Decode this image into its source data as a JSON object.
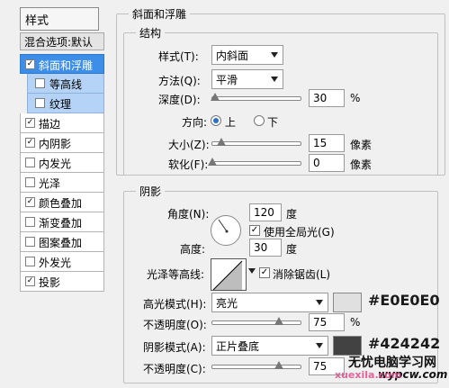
{
  "sidebar": {
    "header": "样式",
    "blend_options": "混合选项:默认",
    "items": [
      {
        "label": "斜面和浮雕",
        "checked": true,
        "selected": true,
        "sub": false
      },
      {
        "label": "等高线",
        "checked": false,
        "selected": false,
        "sub": true
      },
      {
        "label": "纹理",
        "checked": false,
        "selected": false,
        "sub": true
      },
      {
        "label": "描边",
        "checked": true,
        "selected": false,
        "sub": false
      },
      {
        "label": "内阴影",
        "checked": true,
        "selected": false,
        "sub": false
      },
      {
        "label": "内发光",
        "checked": false,
        "selected": false,
        "sub": false
      },
      {
        "label": "光泽",
        "checked": false,
        "selected": false,
        "sub": false
      },
      {
        "label": "颜色叠加",
        "checked": true,
        "selected": false,
        "sub": false
      },
      {
        "label": "渐变叠加",
        "checked": false,
        "selected": false,
        "sub": false
      },
      {
        "label": "图案叠加",
        "checked": false,
        "selected": false,
        "sub": false
      },
      {
        "label": "外发光",
        "checked": false,
        "selected": false,
        "sub": false
      },
      {
        "label": "投影",
        "checked": true,
        "selected": false,
        "sub": false
      }
    ]
  },
  "bevel": {
    "title": "斜面和浮雕",
    "structure": {
      "title": "结构",
      "style_label": "样式(T):",
      "style_value": "内斜面",
      "technique_label": "方法(Q):",
      "technique_value": "平滑",
      "depth_label": "深度(D):",
      "depth_value": "30",
      "depth_unit": "%",
      "depth_level": 0.03,
      "direction_label": "方向:",
      "direction_up": "上",
      "direction_down": "下",
      "direction_selected": "up",
      "size_label": "大小(Z):",
      "size_value": "15",
      "size_unit": "像素",
      "size_level": 0.1,
      "soften_label": "软化(F):",
      "soften_value": "0",
      "soften_unit": "像素",
      "soften_level": 0.0
    },
    "shading": {
      "title": "阴影",
      "angle_label": "角度(N):",
      "angle_value": "120",
      "angle_unit": "度",
      "global_light_label": "使用全局光(G)",
      "global_light_checked": true,
      "altitude_label": "高度:",
      "altitude_value": "30",
      "altitude_unit": "度",
      "gloss_contour_label": "光泽等高线:",
      "antialias_label": "消除锯齿(L)",
      "antialias_checked": true,
      "highlight_mode_label": "高光模式(H):",
      "highlight_mode_value": "亮光",
      "highlight_color": "#E0E0E0",
      "highlight_hex_label": "#E0E0E0",
      "highlight_opacity_label": "不透明度(O):",
      "highlight_opacity_value": "75",
      "highlight_opacity_unit": "%",
      "highlight_opacity_level": 0.75,
      "shadow_mode_label": "阴影模式(A):",
      "shadow_mode_value": "正片叠底",
      "shadow_color": "#424242",
      "shadow_hex_label": "#424242",
      "shadow_opacity_label": "不透明度(C):",
      "shadow_opacity_value": "75",
      "shadow_opacity_level": 0.75
    }
  },
  "watermark": {
    "line1": "无忧电脑学习网",
    "line2": "wypcw.com",
    "line3": "xuexila.com"
  }
}
